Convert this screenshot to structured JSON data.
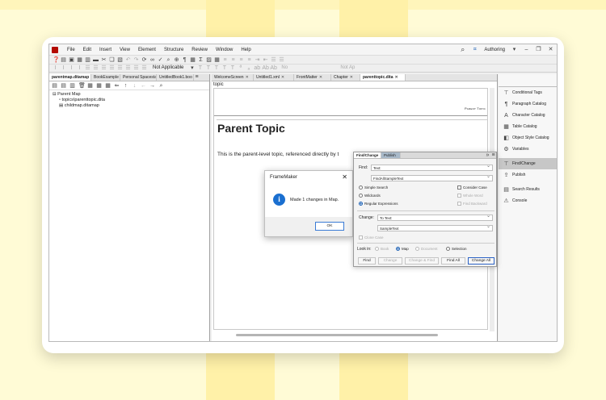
{
  "menubar": {
    "items": [
      "File",
      "Edit",
      "Insert",
      "View",
      "Element",
      "Structure",
      "Review",
      "Window",
      "Help"
    ],
    "workspace": "Authoring",
    "icons": [
      "search-icon",
      "frame-icon"
    ]
  },
  "toolbar2": {
    "not_applicable_1": "Not Applicable",
    "no_label": "No",
    "not_applicable_2": "Not Ap"
  },
  "left_panel": {
    "tabs": [
      "parentmap.ditamap",
      "BookExample",
      "Personal Spacestat",
      "UntitledBook1.boo"
    ],
    "tree": [
      "Parent Map",
      "topics\\parenttopic.dita",
      "childmap.ditamap"
    ]
  },
  "doc_tabs": [
    "WelcomeScreen",
    "Untitled1.xml",
    "FrontMatter",
    "Chapter",
    "parenttopic.dita"
  ],
  "document": {
    "element_tag": "topic",
    "running_header": "Parent Topic",
    "heading": "Parent Topic",
    "body": "This is the parent-level topic, referenced directly by t"
  },
  "right_panel": {
    "items": [
      "Conditional Tags",
      "Paragraph Catalog",
      "Character Catalog",
      "Table Catalog",
      "Object Style Catalog",
      "Variables",
      "Find/Change",
      "Publish",
      "Search Results",
      "Console"
    ]
  },
  "message_dialog": {
    "title": "FrameMaker",
    "message": "Made 1 changes in Map.",
    "ok": "OK"
  },
  "find_change": {
    "tabs": [
      "Find/Change",
      "Publish"
    ],
    "find_label": "Find:",
    "find_type": "Text:",
    "find_value": "FindAllSampleText",
    "options": {
      "simple": "Simple Search",
      "wildcards": "Wildcards",
      "regex": "Regular Expressions",
      "consider_case": "Consider Case",
      "whole_word": "Whole Word",
      "find_backward": "Find Backward"
    },
    "change_label": "Change:",
    "change_type": "To Text:",
    "change_value": "SampleText",
    "clone_case": "Clone Case",
    "look_in_label": "Look in:",
    "look_in": [
      "Book",
      "Map",
      "Document",
      "Selection"
    ],
    "buttons": [
      "Find",
      "Change",
      "Change & Find",
      "Find All",
      "Change All"
    ]
  },
  "colors": {
    "accent": "#1a5fb4",
    "logo": "#b30b00",
    "background": "#fff8c4"
  }
}
